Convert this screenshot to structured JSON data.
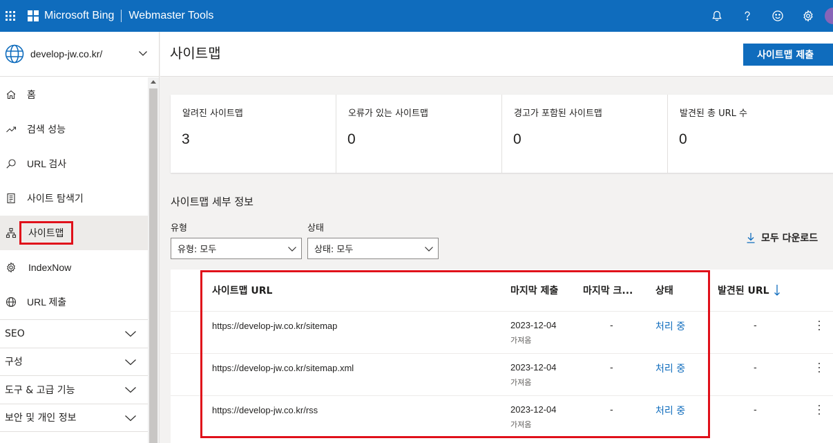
{
  "topbar": {
    "brand": "Microsoft Bing",
    "product": "Webmaster Tools",
    "icons": [
      "waffle-icon",
      "bell-icon",
      "help-icon",
      "smiley-icon",
      "gear-icon",
      "avatar"
    ]
  },
  "sidebar": {
    "site": "develop-jw.co.kr/",
    "items": [
      {
        "label": "홈",
        "icon": "home-icon"
      },
      {
        "label": "검색 성능",
        "icon": "trend-icon"
      },
      {
        "label": "URL 검사",
        "icon": "search-icon"
      },
      {
        "label": "사이트 탐색기",
        "icon": "document-icon"
      },
      {
        "label": "사이트맵",
        "icon": "sitemap-icon"
      },
      {
        "label": "IndexNow",
        "icon": "gear-icon"
      },
      {
        "label": "URL 제출",
        "icon": "globe-icon"
      }
    ],
    "groups": [
      {
        "label": "SEO"
      },
      {
        "label": "구성"
      },
      {
        "label": "도구 & 고급 기능"
      },
      {
        "label": "보안 및 개인 정보"
      }
    ]
  },
  "page": {
    "title": "사이트맵",
    "submit_button": "사이트맵 제출"
  },
  "stats": [
    {
      "label": "알려진 사이트맵",
      "value": "3"
    },
    {
      "label": "오류가 있는 사이트맵",
      "value": "0"
    },
    {
      "label": "경고가 포함된 사이트맵",
      "value": "0"
    },
    {
      "label": "발견된 총 URL 수",
      "value": "0"
    }
  ],
  "details": {
    "title": "사이트맵 세부 정보",
    "filter_type_label": "유형",
    "filter_type_value": "유형: 모두",
    "filter_status_label": "상태",
    "filter_status_value": "상태: 모두",
    "download_label": "모두 다운로드"
  },
  "table": {
    "columns": [
      "사이트맵 URL",
      "마지막 제출",
      "마지막 크...",
      "상태",
      "발견된 URL"
    ],
    "rows": [
      {
        "url": "https://develop-jw.co.kr/sitemap",
        "submitted": "2023-12-04",
        "submitted_sub": "가져옴",
        "crawled": "-",
        "status": "처리 중",
        "discovered": "-"
      },
      {
        "url": "https://develop-jw.co.kr/sitemap.xml",
        "submitted": "2023-12-04",
        "submitted_sub": "가져옴",
        "crawled": "-",
        "status": "처리 중",
        "discovered": "-"
      },
      {
        "url": "https://develop-jw.co.kr/rss",
        "submitted": "2023-12-04",
        "submitted_sub": "가져옴",
        "crawled": "-",
        "status": "처리 중",
        "discovered": "-"
      }
    ]
  },
  "colors": {
    "brand_blue": "#0f6cbd",
    "highlight_red": "#e0101a"
  }
}
